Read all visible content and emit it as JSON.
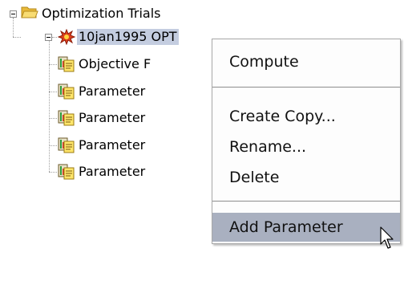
{
  "tree": {
    "root": {
      "label": "Optimization Trials",
      "icon": "folder-open-icon"
    },
    "trial": {
      "label": "10jan1995 OPT",
      "icon": "trial-burst-icon"
    },
    "children": [
      {
        "label": "Objective F",
        "icon": "parameter-doc-icon"
      },
      {
        "label": "Parameter",
        "icon": "parameter-doc-icon"
      },
      {
        "label": "Parameter",
        "icon": "parameter-doc-icon"
      },
      {
        "label": "Parameter",
        "icon": "parameter-doc-icon"
      },
      {
        "label": "Parameter",
        "icon": "parameter-doc-icon"
      }
    ]
  },
  "context_menu": {
    "items": [
      {
        "label": "Compute"
      },
      {
        "label": "Create Copy..."
      },
      {
        "label": "Rename..."
      },
      {
        "label": "Delete"
      },
      {
        "label": "Add Parameter",
        "hover": true
      }
    ]
  },
  "colors": {
    "selection": "#c4cde0",
    "menu_hover": "#a9b0c0",
    "folder": "#f5d46a"
  }
}
